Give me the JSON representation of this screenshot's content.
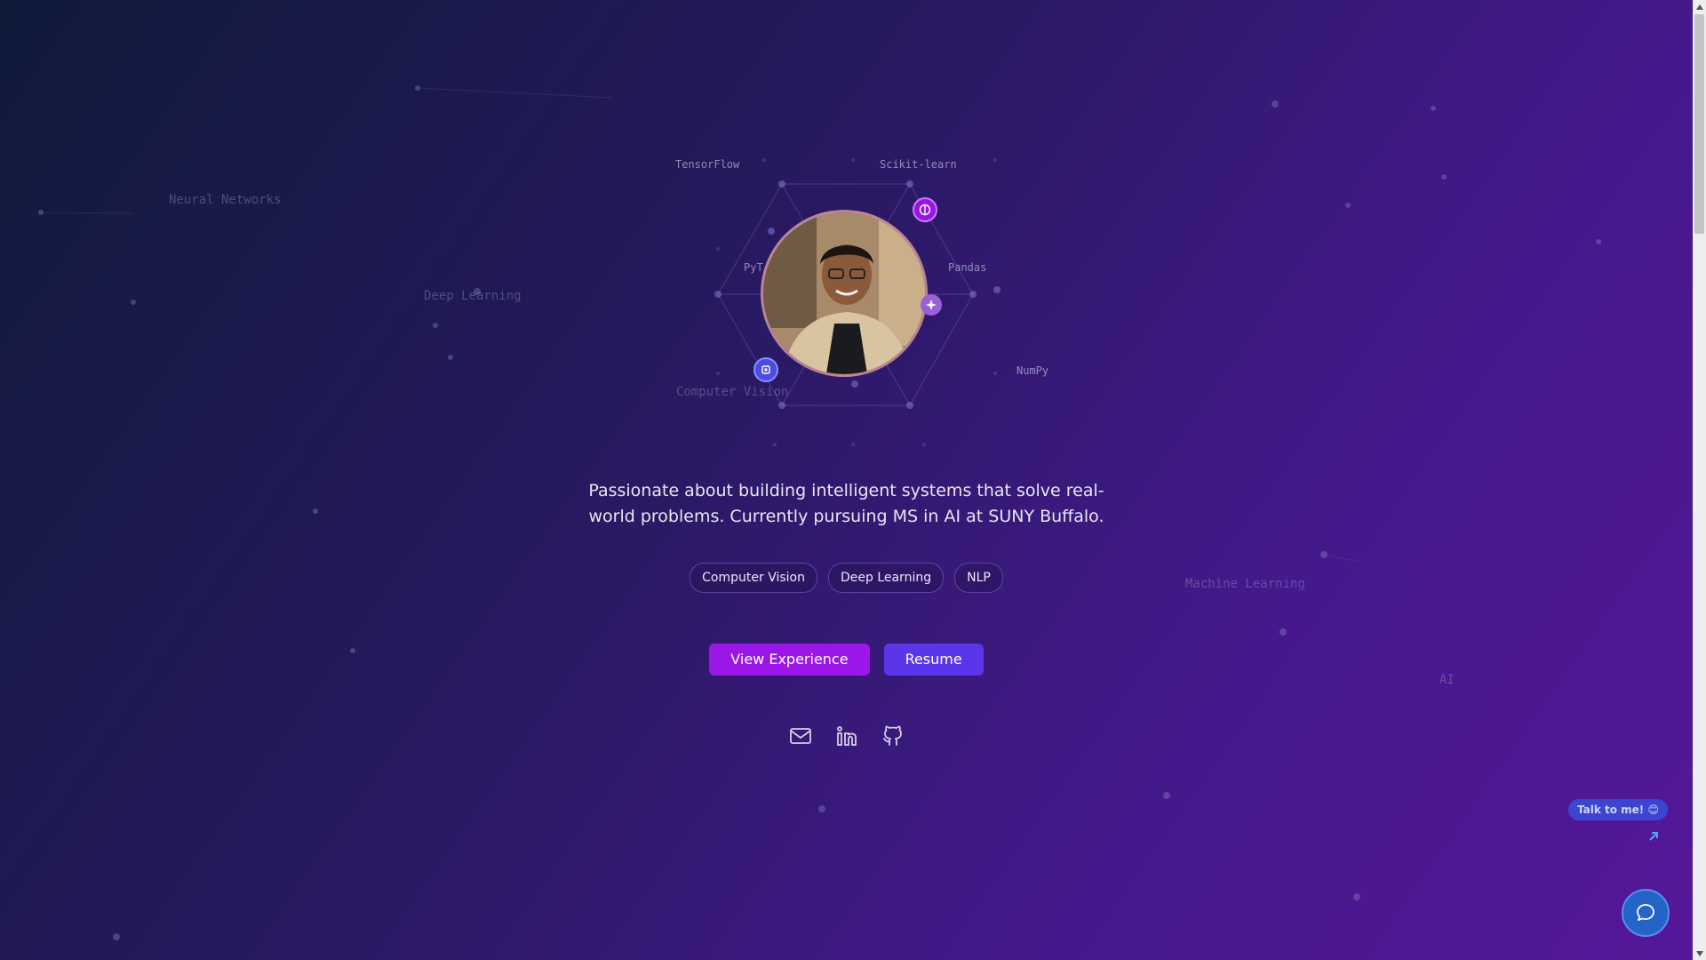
{
  "background_words": [
    "Neural Networks",
    "Deep Learning",
    "Computer Vision",
    "Machine Learning",
    "AI"
  ],
  "tech_labels": [
    "TensorFlow",
    "Scikit-learn",
    "PyT",
    "Pandas",
    "NumPy"
  ],
  "avatar": {
    "description_icon": "profile-photo"
  },
  "badges": [
    "brain-icon",
    "sparkle-icon",
    "chip-icon"
  ],
  "tagline": "Passionate about building intelligent systems that solve real-world problems. Currently pursuing MS in AI at SUNY Buffalo.",
  "chips": [
    "Computer Vision",
    "Deep Learning",
    "NLP"
  ],
  "buttons": {
    "experience": "View Experience",
    "resume": "Resume"
  },
  "socials": [
    "mail-icon",
    "linkedin-icon",
    "github-icon"
  ],
  "talk_label": "Talk to me! 😊",
  "colors": {
    "accent_primary": "#9b17e8",
    "accent_secondary": "#5a35ea",
    "chat": "#2463c8"
  }
}
